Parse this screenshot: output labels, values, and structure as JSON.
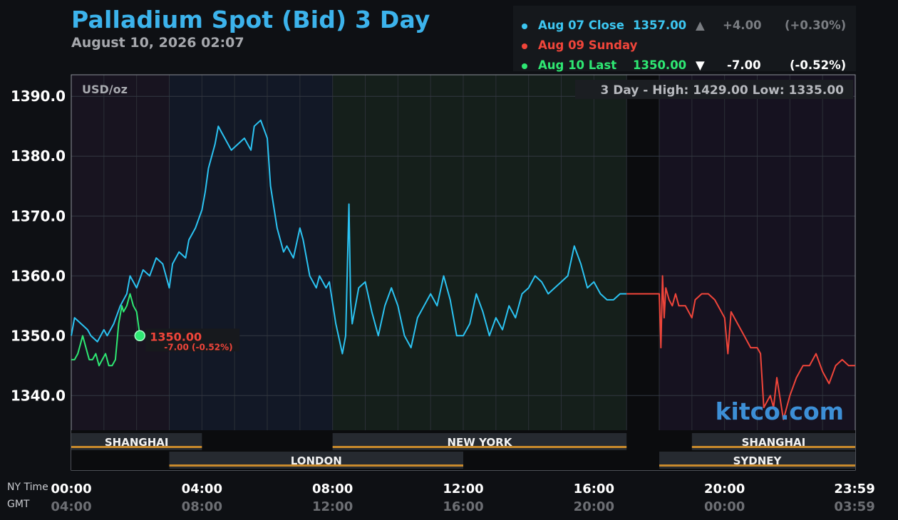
{
  "header": {
    "title": "Palladium Spot (Bid) 3 Day",
    "date": "August 10, 2026 02:07"
  },
  "legend": {
    "rows": [
      {
        "label": "Aug 07 Close",
        "price": "1357.00",
        "arrow": "▲",
        "change": "+4.00",
        "pct": "(+0.30%)",
        "color": "#3cc6f0"
      },
      {
        "label": "Aug 09 Sunday",
        "price": "",
        "arrow": "",
        "change": "",
        "pct": "",
        "color": "#f0453a"
      },
      {
        "label": "Aug 10 Last",
        "price": "1350.00",
        "arrow": "▼",
        "change": "-7.00",
        "pct": "(-0.52%)",
        "color": "#2ee873"
      }
    ]
  },
  "chart_data": {
    "type": "line",
    "unit_label": "USD/oz",
    "high_low": "3 Day - High: 1429.00  Low: 1335.00",
    "watermark": "kitco.com",
    "y_ticks": [
      "1390.0",
      "1380.0",
      "1370.0",
      "1360.0",
      "1350.0",
      "1340.0"
    ],
    "y_tick_values": [
      1390,
      1380,
      1370,
      1360,
      1350,
      1340
    ],
    "ylim": [
      1334.2,
      1393.6
    ],
    "xlim_hours": [
      0,
      24
    ],
    "x_ticks_ny": [
      "00:00",
      "04:00",
      "08:00",
      "12:00",
      "16:00",
      "20:00",
      "23:59"
    ],
    "x_ticks_gmt": [
      "04:00",
      "08:00",
      "12:00",
      "16:00",
      "20:00",
      "00:00",
      "03:59"
    ],
    "x_tick_hours": [
      0,
      4,
      8,
      12,
      16,
      20,
      23.98
    ],
    "last_marker": {
      "price": "1350.00",
      "change": "-7.00 (-0.52%)",
      "hour": 2.1,
      "value": 1350
    },
    "sessions": [
      {
        "name": "SHANGHAI",
        "row": 1,
        "start": 0,
        "end": 4
      },
      {
        "name": "NEW YORK",
        "row": 1,
        "start": 8,
        "end": 17
      },
      {
        "name": "SHANGHAI",
        "row": 1,
        "start": 19,
        "end": 24
      },
      {
        "name": "LONDON",
        "row": 2,
        "start": 3,
        "end": 12
      },
      {
        "name": "SYDNEY",
        "row": 2,
        "start": 18,
        "end": 24
      }
    ],
    "series": [
      {
        "name": "Aug 07 Close",
        "color": "#2bc3f2",
        "x": [
          0,
          0.1,
          0.3,
          0.5,
          0.6,
          0.8,
          1.0,
          1.1,
          1.3,
          1.5,
          1.7,
          1.8,
          2.0,
          2.2,
          2.4,
          2.6,
          2.8,
          3.0,
          3.1,
          3.3,
          3.5,
          3.6,
          3.8,
          4.0,
          4.1,
          4.2,
          4.4,
          4.5,
          4.6,
          4.7,
          4.9,
          5.1,
          5.3,
          5.5,
          5.6,
          5.8,
          6.0,
          6.1,
          6.3,
          6.5,
          6.6,
          6.8,
          7.0,
          7.1,
          7.3,
          7.5,
          7.6,
          7.8,
          7.9,
          8.1,
          8.3,
          8.4,
          8.5,
          8.55,
          8.6,
          8.8,
          9.0,
          9.2,
          9.4,
          9.6,
          9.8,
          10.0,
          10.2,
          10.4,
          10.6,
          10.8,
          11.0,
          11.2,
          11.4,
          11.6,
          11.8,
          12.0,
          12.2,
          12.4,
          12.6,
          12.8,
          13.0,
          13.2,
          13.4,
          13.6,
          13.8,
          14.0,
          14.2,
          14.4,
          14.6,
          14.8,
          15.0,
          15.2,
          15.4,
          15.6,
          15.8,
          16.0,
          16.2,
          16.4,
          16.6,
          16.8,
          17.0
        ],
        "values": [
          1350,
          1353,
          1352,
          1351,
          1350,
          1349,
          1351,
          1350,
          1352,
          1355,
          1357,
          1360,
          1358,
          1361,
          1360,
          1363,
          1362,
          1358,
          1362,
          1364,
          1363,
          1366,
          1368,
          1371,
          1374,
          1378,
          1382,
          1385,
          1384,
          1383,
          1381,
          1382,
          1383,
          1381,
          1385,
          1386,
          1383,
          1375,
          1368,
          1364,
          1365,
          1363,
          1368,
          1366,
          1360,
          1358,
          1360,
          1358,
          1359,
          1352,
          1347,
          1350,
          1372,
          1356,
          1352,
          1358,
          1359,
          1354,
          1350,
          1355,
          1358,
          1355,
          1350,
          1348,
          1353,
          1355,
          1357,
          1355,
          1360,
          1356,
          1350,
          1350,
          1352,
          1357,
          1354,
          1350,
          1353,
          1351,
          1355,
          1353,
          1357,
          1358,
          1360,
          1359,
          1357,
          1358,
          1359,
          1360,
          1365,
          1362,
          1358,
          1359,
          1357,
          1356,
          1356,
          1357,
          1357
        ]
      },
      {
        "name": "Aug 09 Sunday",
        "color": "#f0453a",
        "x": [
          17.0,
          18.0,
          18.05,
          18.1,
          18.15,
          18.2,
          18.3,
          18.4,
          18.5,
          18.6,
          18.8,
          19.0,
          19.1,
          19.3,
          19.5,
          19.7,
          19.9,
          20.0,
          20.1,
          20.2,
          20.4,
          20.6,
          20.8,
          21.0,
          21.1,
          21.2,
          21.4,
          21.5,
          21.6,
          21.8,
          21.9,
          22.0,
          22.2,
          22.4,
          22.6,
          22.8,
          23.0,
          23.2,
          23.4,
          23.6,
          23.8,
          24.0
        ],
        "values": [
          1357,
          1357,
          1348,
          1360,
          1353,
          1358,
          1356,
          1355,
          1357,
          1355,
          1355,
          1353,
          1356,
          1357,
          1357,
          1356,
          1354,
          1353,
          1347,
          1354,
          1352,
          1350,
          1348,
          1348,
          1347,
          1338,
          1340,
          1338,
          1343,
          1336,
          1338,
          1340,
          1343,
          1345,
          1345,
          1347,
          1344,
          1342,
          1345,
          1346,
          1345,
          1345
        ]
      },
      {
        "name": "Aug 10 Last",
        "color": "#2ee873",
        "x": [
          0,
          0.1,
          0.2,
          0.3,
          0.35,
          0.45,
          0.55,
          0.65,
          0.75,
          0.85,
          0.95,
          1.05,
          1.15,
          1.25,
          1.35,
          1.45,
          1.55,
          1.6,
          1.7,
          1.8,
          1.9,
          2.0,
          2.1
        ],
        "values": [
          1346,
          1346,
          1347,
          1349,
          1350,
          1348,
          1346,
          1346,
          1347,
          1345,
          1346,
          1347,
          1345,
          1345,
          1346,
          1352,
          1355,
          1354,
          1355,
          1357,
          1355,
          1354,
          1350
        ]
      }
    ]
  },
  "footer": {
    "ny_label": "NY Time",
    "gmt_label": "GMT"
  }
}
